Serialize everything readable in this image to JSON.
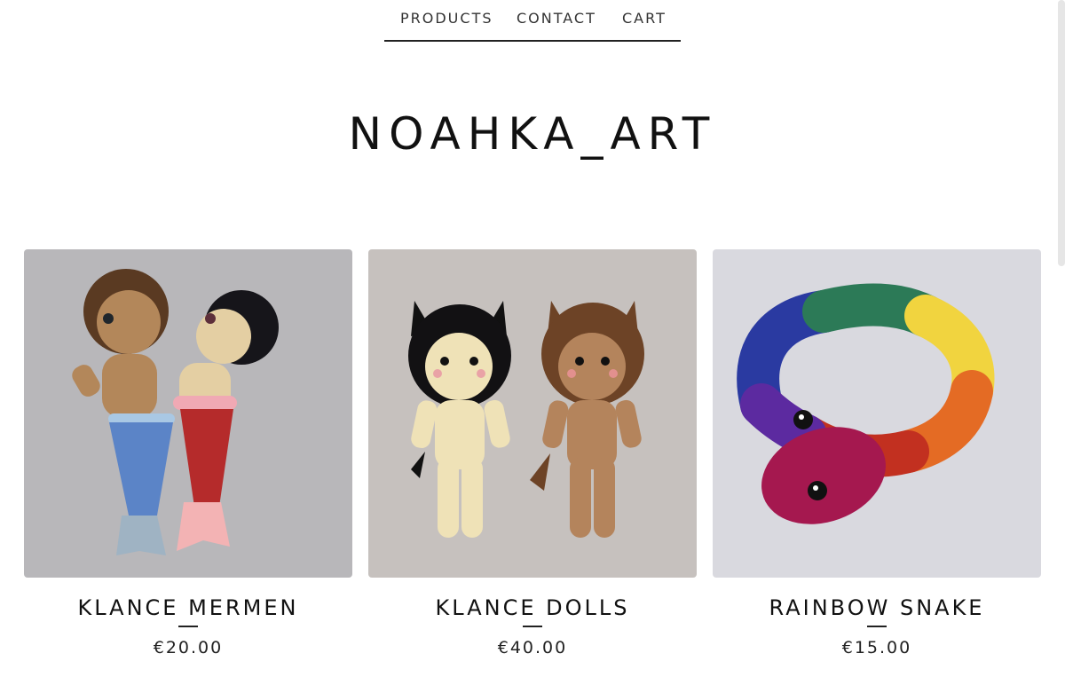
{
  "nav": {
    "products": "PRODUCTS",
    "contact": "CONTACT",
    "cart": "CART"
  },
  "store": {
    "name": "NOAHKA_ART"
  },
  "products": [
    {
      "title": "KLANCE MERMEN",
      "price": "€20.00"
    },
    {
      "title": "KLANCE DOLLS",
      "price": "€40.00"
    },
    {
      "title": "RAINBOW SNAKE",
      "price": "€15.00"
    }
  ],
  "colors": {
    "accent": "#222222",
    "photo_bg_1": "#b9b8bb",
    "photo_bg_2": "#c6c1bd",
    "photo_bg_3": "#d8d8e0"
  }
}
